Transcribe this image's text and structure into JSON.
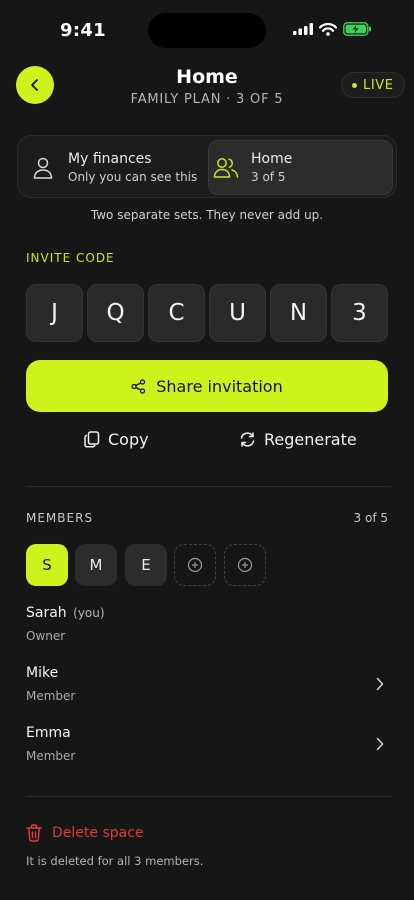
{
  "status_bar": {
    "time": "9:41"
  },
  "header": {
    "title": "Home",
    "subtitle": "FAMILY PLAN · 3 OF 5",
    "badge": "LIVE"
  },
  "switcher": {
    "options": [
      {
        "label": "My finances",
        "sub": "Only you can see this",
        "icon": "person-icon",
        "selected": false
      },
      {
        "label": "Home",
        "sub": "3 of 5",
        "icon": "group-icon",
        "selected": true
      }
    ],
    "note": "Two separate sets. They never add up."
  },
  "invite": {
    "label": "INVITE CODE",
    "code": [
      "J",
      "Q",
      "C",
      "U",
      "N",
      "3"
    ],
    "share_label": "Share invitation",
    "copy_label": "Copy",
    "regenerate_label": "Regenerate"
  },
  "members": {
    "label": "MEMBERS",
    "count": "3 of 5",
    "avatars": [
      "S",
      "M",
      "E"
    ],
    "list": [
      {
        "name": "Sarah",
        "you": "(you)",
        "role": "Owner"
      },
      {
        "name": "Mike",
        "role": "Member"
      },
      {
        "name": "Emma",
        "role": "Member"
      }
    ]
  },
  "danger": {
    "delete_label": "Delete space",
    "delete_note": "It is deleted for all 3 members."
  },
  "colors": {
    "accent": "#cef21c",
    "background": "#161616",
    "danger": "#e23a3a"
  }
}
